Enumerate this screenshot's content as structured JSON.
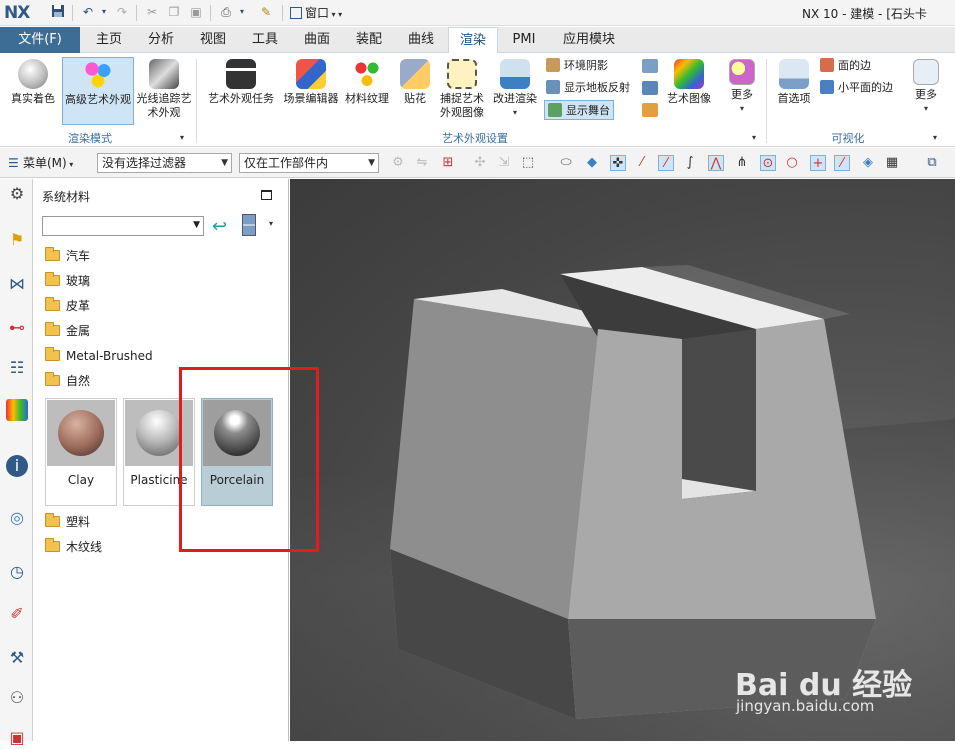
{
  "titlebar": {
    "logo": "NX",
    "window_menu": "窗口",
    "title": "NX 10 - 建模 - [石头卡"
  },
  "tabs": [
    "文件(F)",
    "主页",
    "分析",
    "视图",
    "工具",
    "曲面",
    "装配",
    "曲线",
    "渲染",
    "PMI",
    "应用模块"
  ],
  "active_tab": "渲染",
  "ribbon": {
    "render_mode": {
      "group_label": "渲染模式",
      "buttons": [
        "真实着色",
        "高级艺术外观",
        "光线追踪艺术外观"
      ]
    },
    "art_settings": {
      "group_label": "艺术外观设置",
      "buttons": [
        "艺术外观任务",
        "场景编辑器",
        "材料纹理",
        "贴花",
        "捕捉艺术外观图像",
        "改进渲染"
      ],
      "small": [
        "环境阴影",
        "显示地板反射",
        "显示舞台"
      ],
      "art_image": "艺术图像",
      "more": "更多"
    },
    "visualize": {
      "group_label": "可视化",
      "pref": "首选项",
      "small": [
        "面的边",
        "小平面的边"
      ],
      "more": "更多"
    }
  },
  "toolbar": {
    "menu_label": "菜单(M)",
    "filter": "没有选择过滤器",
    "scope": "仅在工作部件内"
  },
  "panel": {
    "title": "系统材料",
    "combo_value": "",
    "folders_top": [
      "汽车",
      "玻璃",
      "皮革",
      "金属",
      "Metal-Brushed",
      "自然"
    ],
    "materials": [
      "Clay",
      "Plasticine",
      "Porcelain"
    ],
    "selected_material": "Porcelain",
    "folders_bottom": [
      "塑料",
      "木纹线"
    ]
  },
  "watermark": {
    "brand": "Bai du 经验",
    "url": "jingyan.baidu.com"
  },
  "colors": {
    "file_tab": "#3d6d95",
    "selection": "#cfe4f5",
    "annotation": "#e21b1b"
  }
}
